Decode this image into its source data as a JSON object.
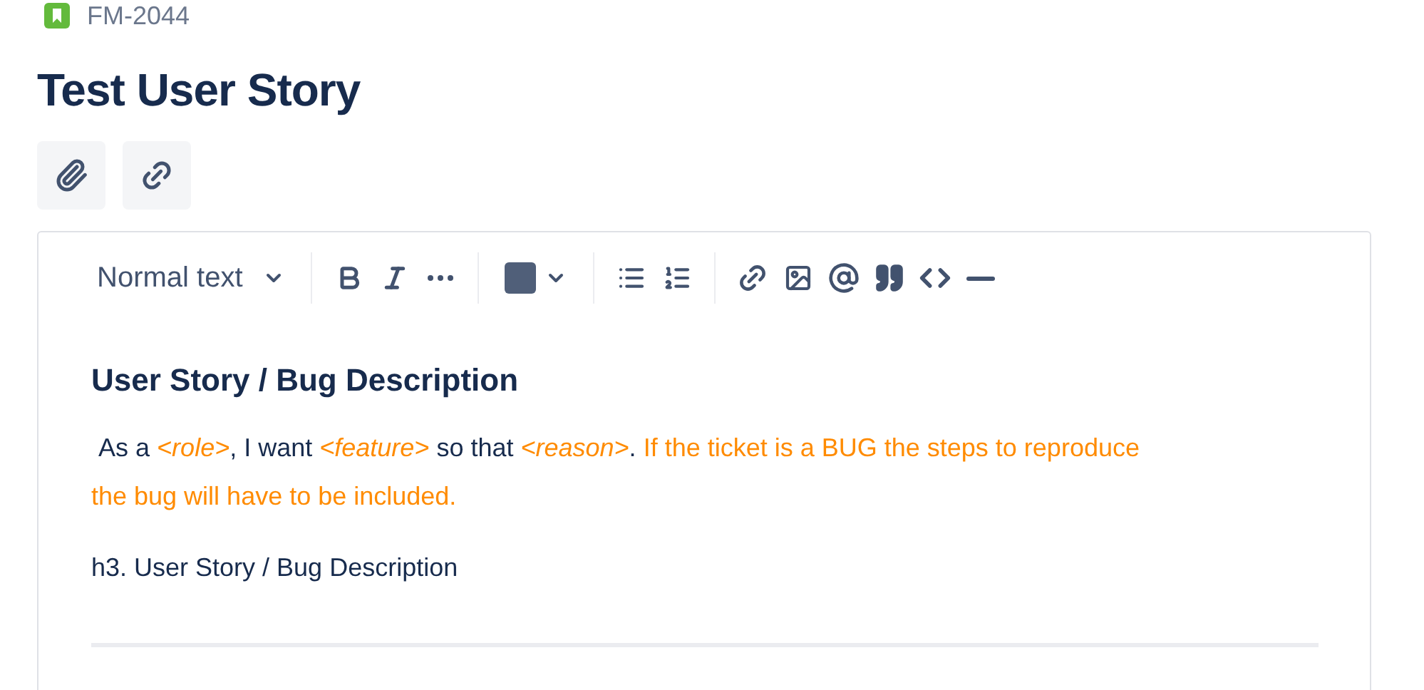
{
  "issue_key": "FM-2044",
  "title": "Test User Story",
  "toolbar": {
    "text_style": "Normal text"
  },
  "content": {
    "heading": "User Story / Bug Description",
    "paragraph": [
      {
        "kind": "plain",
        "text": " As a "
      },
      {
        "kind": "placeholder",
        "text": "<role>"
      },
      {
        "kind": "plain",
        "text": ", I want "
      },
      {
        "kind": "placeholder",
        "text": "<feature>"
      },
      {
        "kind": "plain",
        "text": " so that "
      },
      {
        "kind": "placeholder",
        "text": "<reason>"
      },
      {
        "kind": "plain",
        "text": ". "
      },
      {
        "kind": "note",
        "text": "If the ticket is a BUG the steps to reproduce the bug will have to be included."
      }
    ],
    "line": "h3. User Story / Bug Description"
  }
}
